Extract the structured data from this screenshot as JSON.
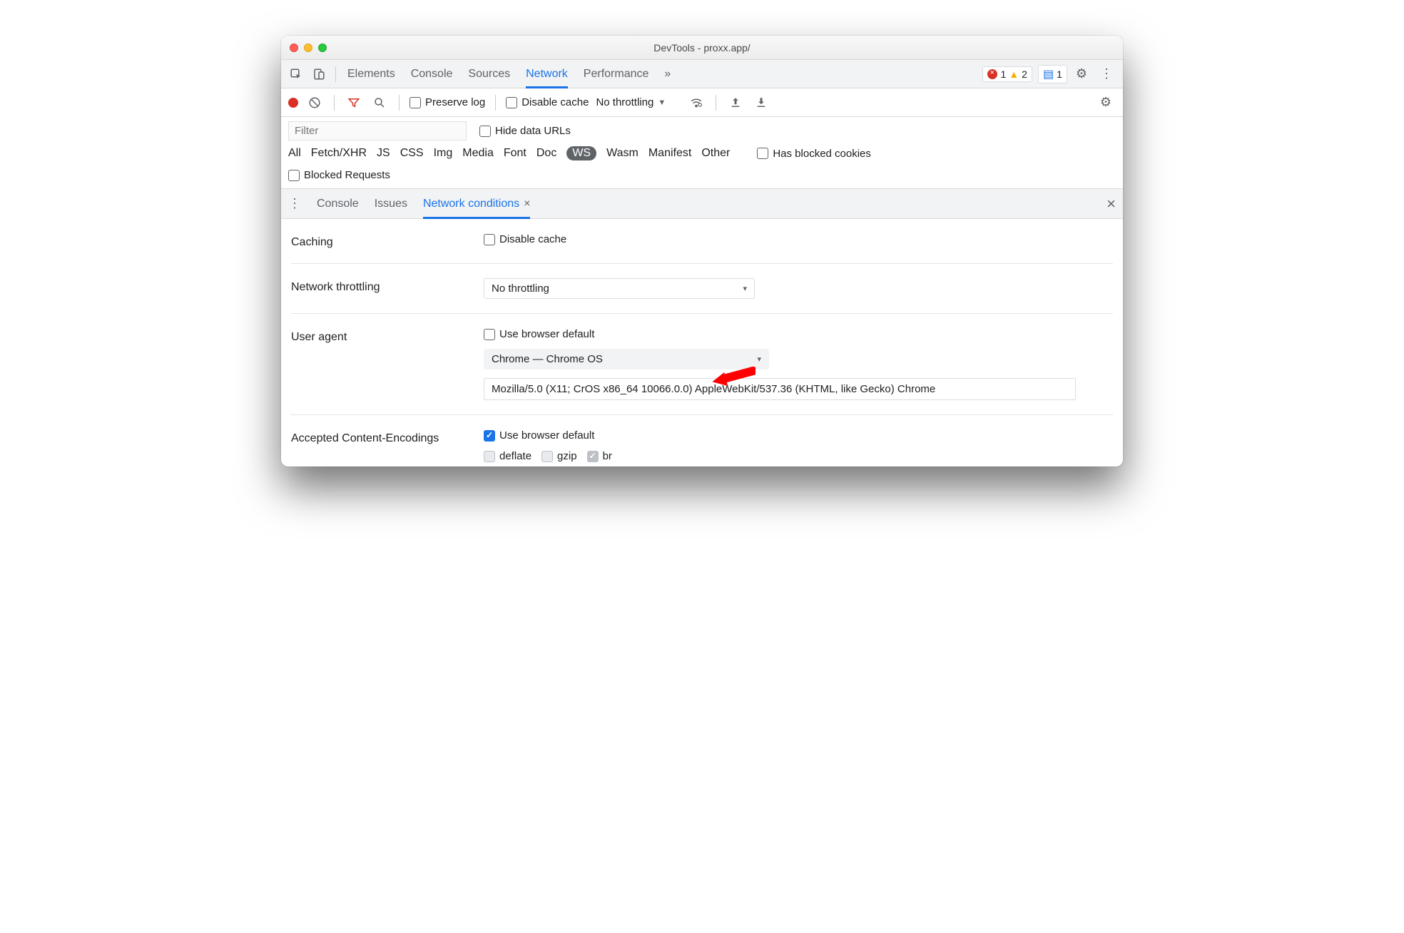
{
  "window": {
    "title": "DevTools - proxx.app/"
  },
  "topTabs": {
    "items": [
      "Elements",
      "Console",
      "Sources",
      "Network",
      "Performance"
    ],
    "overflow": "»",
    "active": "Network"
  },
  "badges": {
    "errors": "1",
    "warnings": "2",
    "messages": "1"
  },
  "netBar": {
    "preserveLog": "Preserve log",
    "disableCache": "Disable cache",
    "throttling": "No throttling"
  },
  "filter": {
    "placeholder": "Filter",
    "hideDataUrls": "Hide data URLs",
    "types": [
      "All",
      "Fetch/XHR",
      "JS",
      "CSS",
      "Img",
      "Media",
      "Font",
      "Doc",
      "WS",
      "Wasm",
      "Manifest",
      "Other"
    ],
    "selected": "WS",
    "hasBlockedCookies": "Has blocked cookies",
    "blockedRequests": "Blocked Requests"
  },
  "drawer": {
    "tabs": [
      "Console",
      "Issues",
      "Network conditions"
    ],
    "active": "Network conditions"
  },
  "form": {
    "caching": {
      "label": "Caching",
      "disableCache": "Disable cache"
    },
    "throttling": {
      "label": "Network throttling",
      "value": "No throttling"
    },
    "ua": {
      "label": "User agent",
      "useDefault": "Use browser default",
      "select": "Chrome — Chrome OS",
      "value": "Mozilla/5.0 (X11; CrOS x86_64 10066.0.0) AppleWebKit/537.36 (KHTML, like Gecko) Chrome"
    },
    "enc": {
      "label": "Accepted Content-Encodings",
      "useDefault": "Use browser default",
      "opts": {
        "deflate": "deflate",
        "gzip": "gzip",
        "br": "br"
      }
    }
  }
}
